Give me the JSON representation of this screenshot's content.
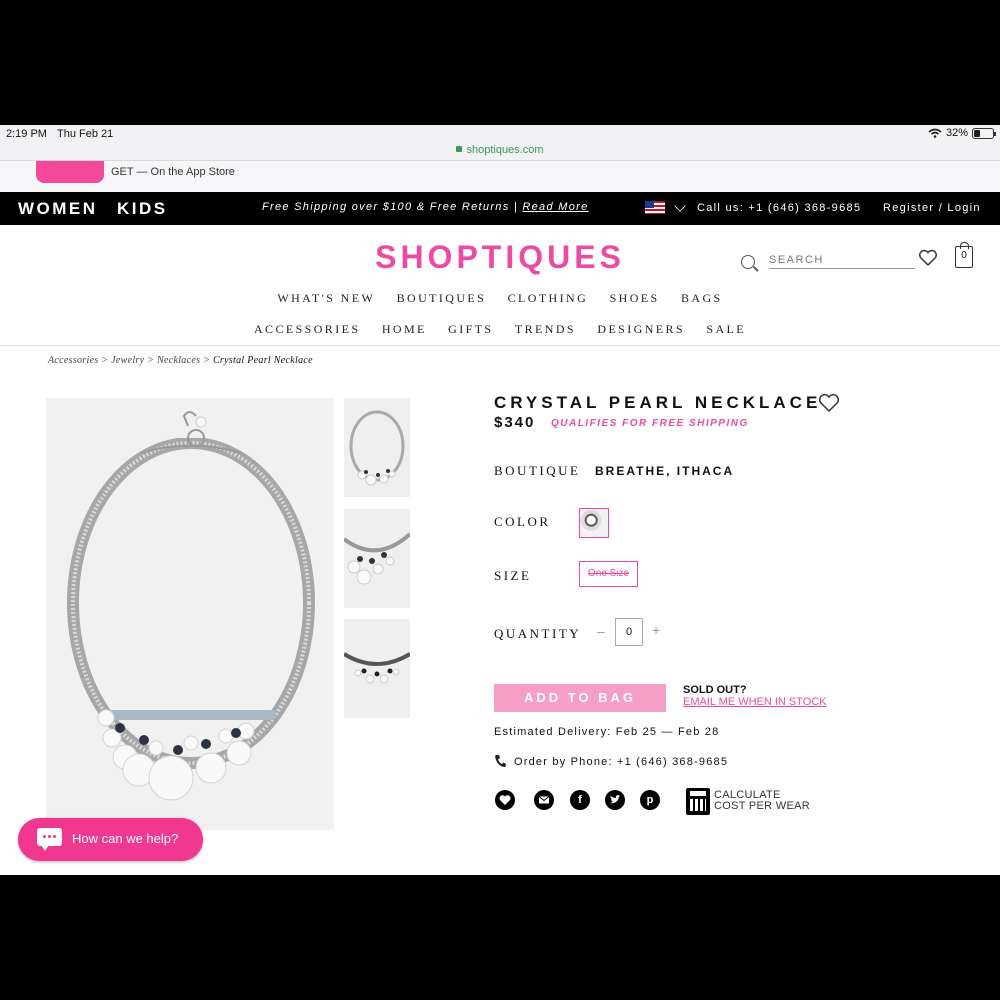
{
  "status_bar": {
    "time": "2:19 PM",
    "date": "Thu Feb 21",
    "battery": "32%"
  },
  "browser": {
    "url": "shoptiques.com"
  },
  "app_banner": {
    "text": "GET — On the App Store"
  },
  "top_nav": {
    "women": "WOMEN",
    "kids": "KIDS",
    "promo": "Free Shipping over $100 & Free Returns |",
    "read_more": "Read More",
    "call": "Call us: +1 (646) 368-9685",
    "login": "Register / Login"
  },
  "header": {
    "logo": "SHOPTIQUES",
    "search_placeholder": "SEARCH",
    "bag_count": "0",
    "nav_row1": [
      "WHAT'S NEW",
      "BOUTIQUES",
      "CLOTHING",
      "SHOES",
      "BAGS"
    ],
    "nav_row2": [
      "ACCESSORIES",
      "HOME",
      "GIFTS",
      "TRENDS",
      "DESIGNERS",
      "SALE"
    ]
  },
  "breadcrumb": {
    "items": [
      "Accessories >",
      "Jewelry >",
      "Necklaces >"
    ],
    "current": "Crystal Pearl Necklace"
  },
  "product": {
    "title": "CRYSTAL PEARL NECKLACE",
    "price": "$340",
    "shipping_note": "QUALIFIES FOR FREE SHIPPING",
    "boutique_label": "BOUTIQUE",
    "boutique_name": "BREATHE, ITHACA",
    "color_label": "COLOR",
    "size_label": "SIZE",
    "size_option": "One Size",
    "quantity_label": "QUANTITY",
    "quantity_minus": "–",
    "quantity_value": "0",
    "quantity_plus": "+",
    "add_to_bag": "ADD TO BAG",
    "sold_out": "SOLD OUT?",
    "email_me": "EMAIL ME WHEN IN STOCK",
    "delivery": "Estimated Delivery: Feb 25 — Feb 28",
    "phone": "Order by Phone: +1 (646) 368-9685",
    "share_icons": [
      "heart-icon",
      "email-icon",
      "facebook-icon",
      "twitter-icon",
      "pinterest-icon"
    ],
    "share_glyphs": {
      "facebook": "f",
      "pinterest": "p"
    },
    "calc_line1": "CALCULATE",
    "calc_line2": "COST PER WEAR"
  },
  "chat": {
    "label": "How can we help?"
  },
  "colors": {
    "brand_pink": "#ec4ba4",
    "button_pink": "#f49ec8",
    "chat_pink": "#f0388f"
  }
}
